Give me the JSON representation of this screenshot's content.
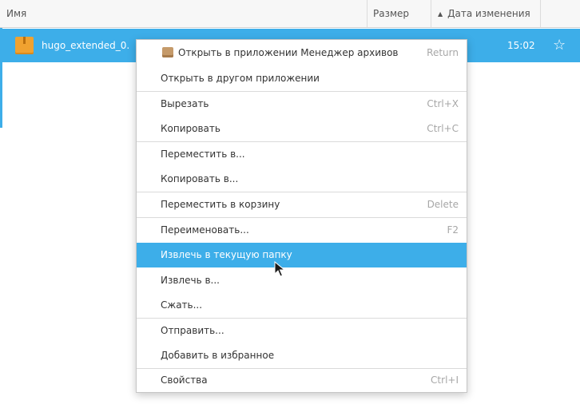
{
  "header": {
    "name_label": "Имя",
    "size_label": "Размер",
    "date_label": "Дата изменения"
  },
  "file": {
    "name": "hugo_extended_0.",
    "time": "15:02",
    "icon": "archive-icon"
  },
  "menu": {
    "items": [
      {
        "label": "Открыть в приложении Менеджер архивов",
        "shortcut": "Return",
        "icon": "archive-manager-icon"
      },
      {
        "label": "Открыть в другом приложении",
        "shortcut": ""
      },
      {
        "label": "Вырезать",
        "shortcut": "Ctrl+X"
      },
      {
        "label": "Копировать",
        "shortcut": "Ctrl+C"
      },
      {
        "label": "Переместить в...",
        "shortcut": ""
      },
      {
        "label": "Копировать в...",
        "shortcut": ""
      },
      {
        "label": "Переместить в корзину",
        "shortcut": "Delete"
      },
      {
        "label": "Переименовать...",
        "shortcut": "F2"
      },
      {
        "label": "Извлечь в текущую папку",
        "shortcut": "",
        "highlighted": true
      },
      {
        "label": "Извлечь в...",
        "shortcut": ""
      },
      {
        "label": "Сжать...",
        "shortcut": ""
      },
      {
        "label": "Отправить...",
        "shortcut": ""
      },
      {
        "label": "Добавить в избранное",
        "shortcut": ""
      },
      {
        "label": "Свойства",
        "shortcut": "Ctrl+I"
      }
    ]
  },
  "colors": {
    "accent": "#3daee9",
    "menu_text": "#333333",
    "shortcut_text": "#a7a7a7"
  }
}
